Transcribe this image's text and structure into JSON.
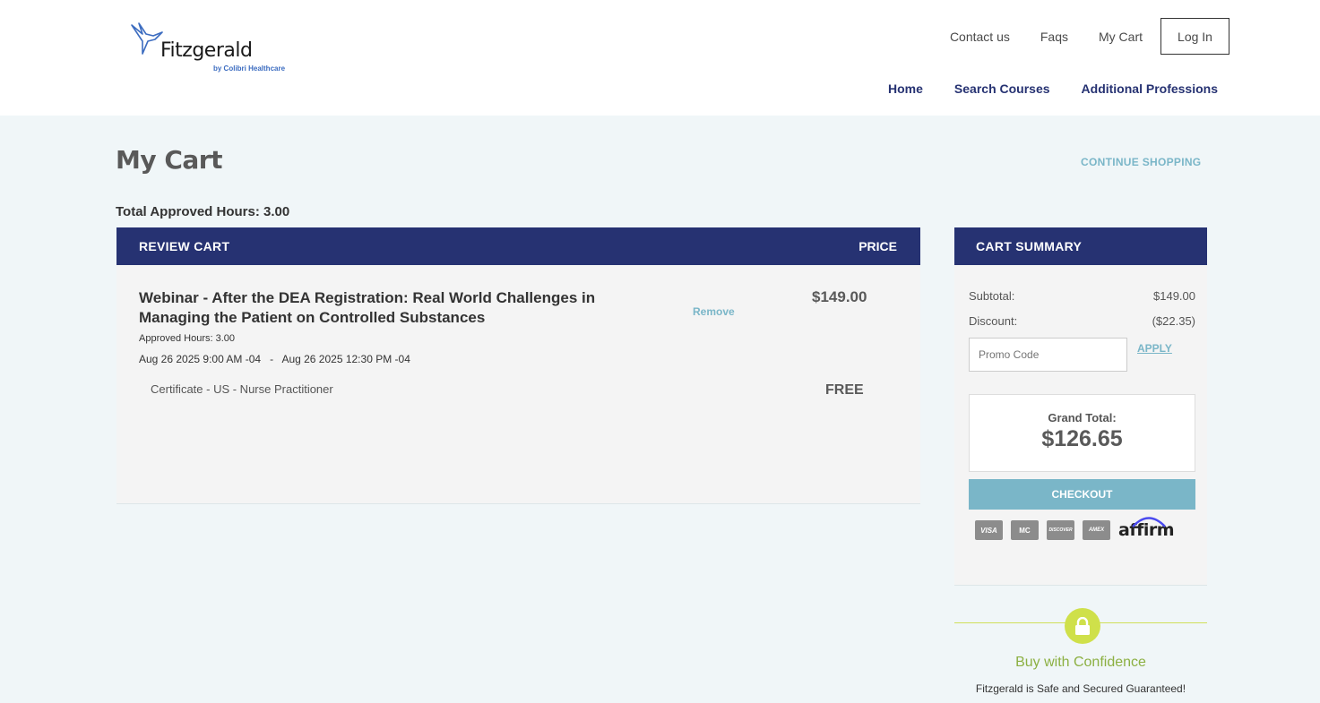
{
  "header": {
    "logo_text": "Fitzgerald",
    "logo_sub": "by Colibri Healthcare",
    "top_links": [
      "Contact us",
      "Faqs",
      "My Cart"
    ],
    "login_label": "Log In",
    "nav": [
      "Home",
      "Search Courses",
      "Additional Professions"
    ]
  },
  "page": {
    "title": "My Cart",
    "continue_label": "CONTINUE SHOPPING",
    "total_hours": "Total Approved Hours: 3.00"
  },
  "review": {
    "header_label": "REVIEW CART",
    "price_label": "PRICE",
    "item": {
      "title": "Webinar - After the DEA Registration: Real World Challenges in Managing the Patient on Controlled Substances",
      "hours": "Approved Hours: 3.00",
      "dates": "Aug 26 2025 9:00 AM -04   -   Aug 26 2025 12:30 PM -04",
      "remove_label": "Remove",
      "price": "$149.00",
      "certificate": "Certificate - US - Nurse Practitioner",
      "certificate_price": "FREE"
    }
  },
  "summary": {
    "header_label": "CART SUMMARY",
    "subtotal_label": "Subtotal:",
    "subtotal_value": "$149.00",
    "discount_label": "Discount:",
    "discount_value": "($22.35)",
    "promo_placeholder": "Promo Code",
    "apply_label": "APPLY",
    "grand_total_label": "Grand Total:",
    "grand_total_value": "$126.65",
    "checkout_label": "CHECKOUT",
    "payment_icons": [
      "visa-icon",
      "mastercard-icon",
      "discover-icon",
      "amex-icon",
      "affirm-logo"
    ],
    "card_labels": [
      "VISA",
      "MC",
      "DISCOVER",
      "AMEX"
    ],
    "affirm_label": "affirm"
  },
  "confidence": {
    "title": "Buy with Confidence",
    "subtitle": "Fitzgerald is Safe and Secured Guaranteed!"
  },
  "colors": {
    "navy": "#263272",
    "accent": "#7ab6c8",
    "page_bg": "#f0f6f8",
    "confidence_green": "#cfe04a"
  }
}
